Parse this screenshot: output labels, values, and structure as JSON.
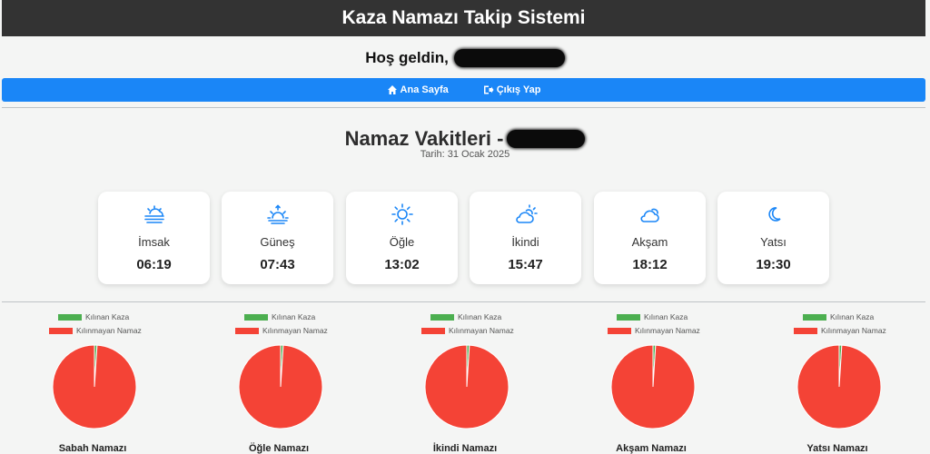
{
  "header": {
    "title": "Kaza Namazı Takip Sistemi"
  },
  "welcome": {
    "text": "Hoş geldin,"
  },
  "nav": {
    "home_label": "Ana Sayfa",
    "logout_label": "Çıkış Yap"
  },
  "prayer_times": {
    "title": "Namaz Vakitleri -",
    "date": "Tarih: 31 Ocak 2025",
    "items": [
      {
        "name": "İmsak",
        "time": "06:19",
        "icon": "fog-sun-icon"
      },
      {
        "name": "Güneş",
        "time": "07:43",
        "icon": "sunrise-icon"
      },
      {
        "name": "Öğle",
        "time": "13:02",
        "icon": "sun-icon"
      },
      {
        "name": "İkindi",
        "time": "15:47",
        "icon": "cloud-sun-icon"
      },
      {
        "name": "Akşam",
        "time": "18:12",
        "icon": "cloud-icon"
      },
      {
        "name": "Yatsı",
        "time": "19:30",
        "icon": "moon-icon"
      }
    ]
  },
  "colors": {
    "header_bg": "#333333",
    "nav_bg": "#1a86f7",
    "kilinan": "#4caf50",
    "kilinmayan": "#f44336",
    "icon": "#1a86f7"
  },
  "chart_data": [
    {
      "type": "pie",
      "title": "Sabah Namazı",
      "legend": [
        "Kılınan Kaza",
        "Kılınmayan Namaz"
      ],
      "values": [
        1,
        99
      ]
    },
    {
      "type": "pie",
      "title": "Öğle Namazı",
      "legend": [
        "Kılınan Kaza",
        "Kılınmayan Namaz"
      ],
      "values": [
        1,
        99
      ]
    },
    {
      "type": "pie",
      "title": "İkindi Namazı",
      "legend": [
        "Kılınan Kaza",
        "Kılınmayan Namaz"
      ],
      "values": [
        1,
        99
      ]
    },
    {
      "type": "pie",
      "title": "Akşam Namazı",
      "legend": [
        "Kılınan Kaza",
        "Kılınmayan Namaz"
      ],
      "values": [
        1,
        99
      ]
    },
    {
      "type": "pie",
      "title": "Yatsı Namazı",
      "legend": [
        "Kılınan Kaza",
        "Kılınmayan Namaz"
      ],
      "values": [
        1,
        99
      ]
    }
  ]
}
